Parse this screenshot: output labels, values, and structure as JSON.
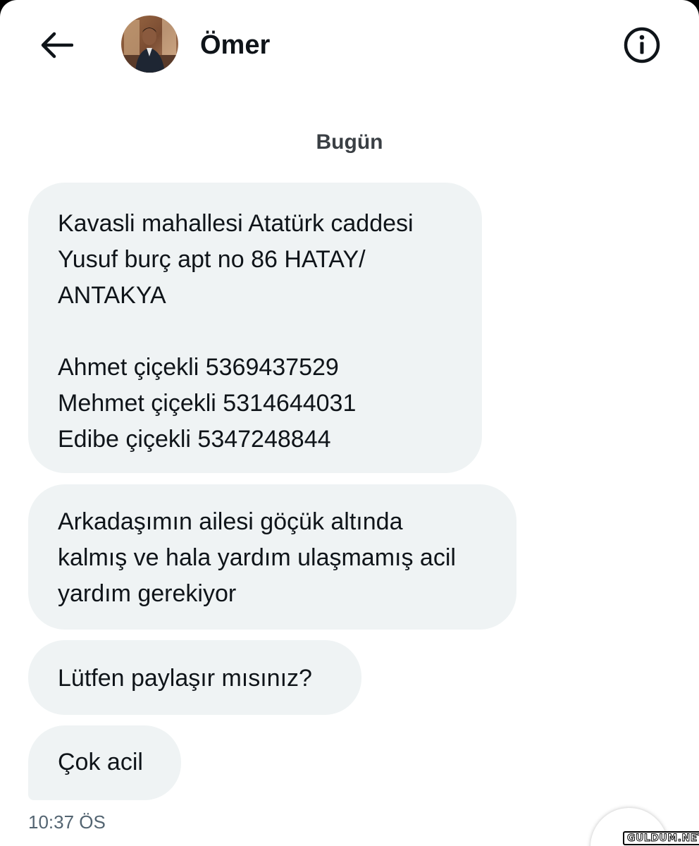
{
  "header": {
    "back_icon": "arrow-left-icon",
    "contact_name": "Ömer",
    "info_icon": "info-circle-icon"
  },
  "conversation": {
    "date_label": "Bugün",
    "messages": [
      {
        "lines": [
          "Kavasli mahallesi Atatürk caddesi",
          "Yusuf burç apt no 86  HATAY/",
          "ANTAKYA",
          "",
          "Ahmet çiçekli 5369437529",
          "Mehmet çiçekli 5314644031",
          "Edibe çiçekli 5347248844"
        ]
      },
      {
        "lines": [
          "Arkadaşımın ailesi göçük altında",
          "kalmış ve hala yardım ulaşmamış acil",
          "yardım gerekiyor"
        ]
      },
      {
        "lines": [
          "Lütfen paylaşır mısınız?"
        ]
      },
      {
        "lines": [
          "Çok acil"
        ]
      }
    ],
    "timestamp": "10:37 ÖS"
  },
  "watermark": {
    "text": "GULDUM.NET"
  },
  "colors": {
    "bubble_bg": "#eff3f4",
    "text": "#0f1419",
    "secondary_text": "#536471"
  }
}
